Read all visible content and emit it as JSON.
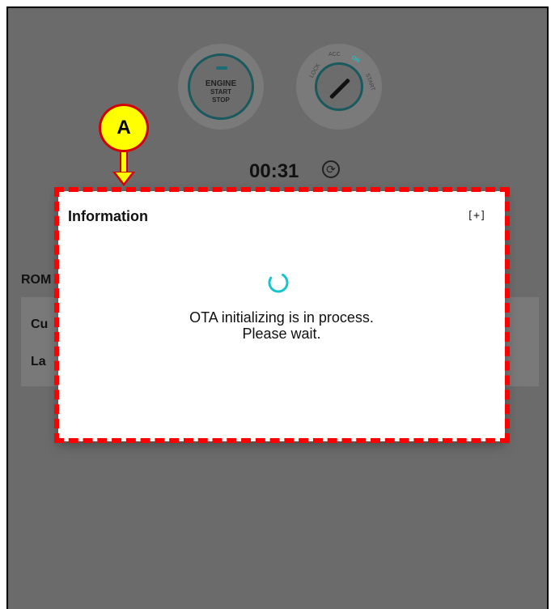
{
  "engine": {
    "line1": "ENGINE",
    "line2": "START",
    "line3": "STOP"
  },
  "key_positions": [
    "LOCK",
    "ACC",
    "ON",
    "START"
  ],
  "timer": {
    "value": "00:31"
  },
  "background": {
    "rom_label": "ROM",
    "current_label": "Cu",
    "latest_label": "La"
  },
  "dialog": {
    "title": "Information",
    "message_line1": "OTA initializing is in process.",
    "message_line2": "Please wait.",
    "expand_glyph": "[+]"
  },
  "annotation": {
    "label": "A"
  },
  "colors": {
    "accent": "#19c4c9",
    "overlay": "#6b6b6b",
    "highlight": "#ff0000",
    "marker": "#ffff00"
  }
}
